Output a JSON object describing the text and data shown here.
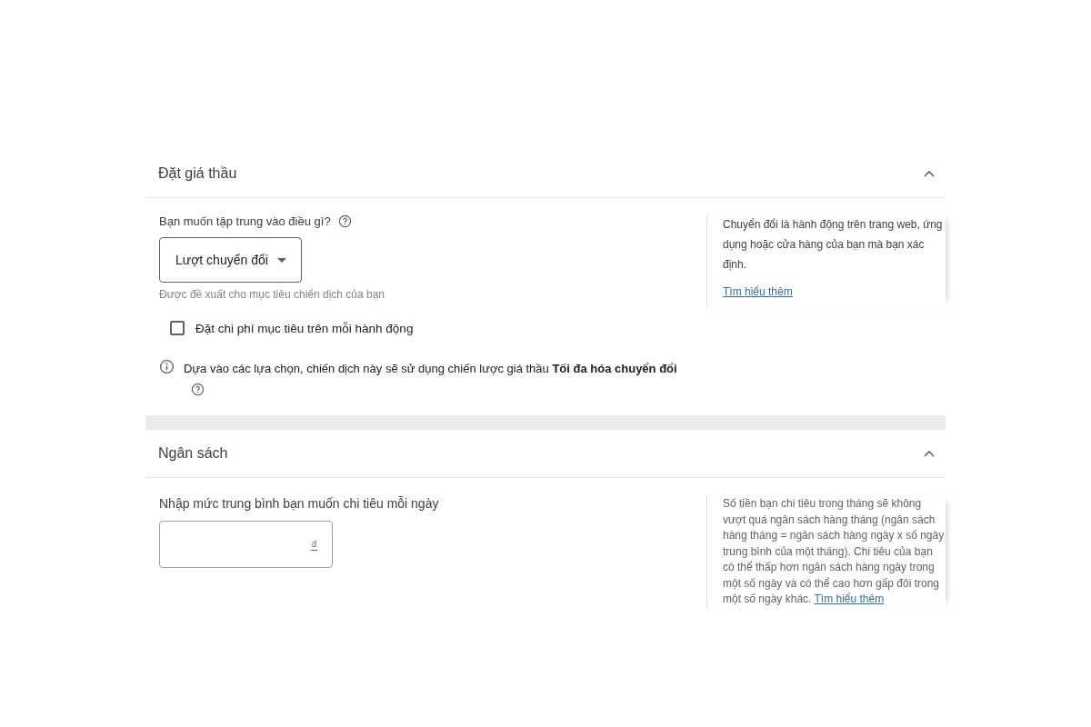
{
  "sections": [
    {
      "title": "Đặt giá thầu",
      "expanded": true,
      "kind": "bidding",
      "question": "Bạn muốn tập trung vào điều gì?",
      "dropdown": {
        "value": "Lượt chuyển đổi"
      },
      "hint": "Được đề xuất cho mục tiêu chiến dịch của bạn",
      "checkbox": {
        "label": "Đặt chi phí mục tiêu trên mỗi hành động",
        "checked": false
      },
      "info": "Dựa vào các lựa chọn, chiến dịch này sẽ sử dụng chiến lược giá thầu **Tối đa hóa chuyển đổi**",
      "help": {
        "text": "Chuyển đổi là hành động trên trang web, ứng dụng hoặc cửa hàng của bạn mà bạn xác định.",
        "link": "Tìm hiểu thêm"
      }
    },
    {
      "title": "Ngân sách",
      "expanded": true,
      "kind": "budget",
      "field_label": "Nhập mức trung bình bạn muốn chi tiêu mỗi ngày",
      "input": {
        "suffix": "₫"
      },
      "help": {
        "text": "Số tiền bạn chi tiêu trong tháng sẽ không vượt quá ngân sách hàng tháng (ngân sách hàng tháng = ngân sách hàng ngày x số ngày trung bình của một tháng). Chi tiêu của bạn có thể thấp hơn ngân sách hàng ngày trong một số ngày và có thể cao hơn gấp đôi trong một số ngày khác.",
        "link": "Tìm hiểu thêm"
      }
    }
  ]
}
